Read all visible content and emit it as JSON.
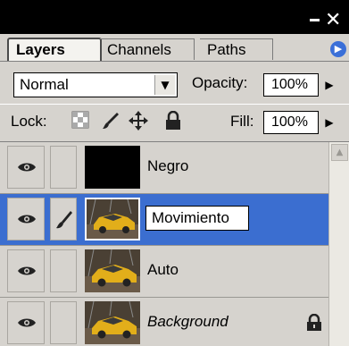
{
  "tabs": [
    {
      "label": "Layers",
      "active": true
    },
    {
      "label": "Channels",
      "active": false
    },
    {
      "label": "Paths",
      "active": false
    }
  ],
  "blend_mode": {
    "value": "Normal"
  },
  "opacity": {
    "label": "Opacity:",
    "value": "100%"
  },
  "lock": {
    "label": "Lock:"
  },
  "fill": {
    "label": "Fill:",
    "value": "100%"
  },
  "layers": [
    {
      "name": "Negro",
      "visible": true,
      "thumbnail": "black",
      "selected": false
    },
    {
      "name": "Movimiento",
      "visible": true,
      "thumbnail": "car",
      "selected": true,
      "editing": true,
      "brush": true
    },
    {
      "name": "Auto",
      "visible": true,
      "thumbnail": "car",
      "selected": false
    },
    {
      "name": "Background",
      "visible": true,
      "thumbnail": "car",
      "selected": false,
      "locked": true,
      "italic": true
    }
  ],
  "colors": {
    "panel": "#d6d3ce",
    "selection": "#3b6ed0",
    "titlebar": "#000000",
    "car": "#e2ae1a"
  }
}
